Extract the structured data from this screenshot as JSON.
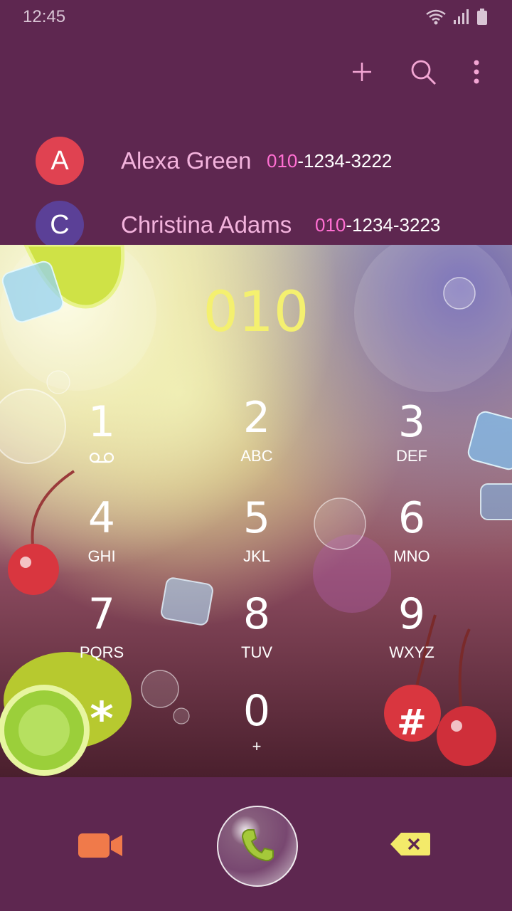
{
  "status_bar": {
    "time": "12:45"
  },
  "contacts": [
    {
      "initial": "A",
      "name": "Alexa Green",
      "number_match": "010",
      "number_rest": "-1234-3222"
    },
    {
      "initial": "C",
      "name": "Christina Adams",
      "number_match": "010",
      "number_rest": "-1234-3223"
    }
  ],
  "dialer": {
    "display": "010"
  },
  "keys": [
    {
      "digit": "1",
      "letters": ""
    },
    {
      "digit": "2",
      "letters": "ABC"
    },
    {
      "digit": "3",
      "letters": "DEF"
    },
    {
      "digit": "4",
      "letters": "GHI"
    },
    {
      "digit": "5",
      "letters": "JKL"
    },
    {
      "digit": "6",
      "letters": "MNO"
    },
    {
      "digit": "7",
      "letters": "PQRS"
    },
    {
      "digit": "8",
      "letters": "TUV"
    },
    {
      "digit": "9",
      "letters": "WXYZ"
    },
    {
      "digit": "*",
      "letters": ""
    },
    {
      "digit": "0",
      "letters": "+"
    },
    {
      "digit": "#",
      "letters": ""
    }
  ],
  "icons": {
    "action_bar": [
      "plus-icon",
      "search-icon",
      "more-vert-icon"
    ],
    "status": [
      "wifi-icon",
      "signal-icon",
      "battery-icon"
    ],
    "voicemail": "voicemail-icon",
    "video_call": "video-camera-icon",
    "call": "phone-icon",
    "delete": "backspace-icon"
  },
  "colors": {
    "background": "#5e2750",
    "accent": "#f3b3dd",
    "number_match": "#ff6fd2",
    "dial_display": "#f4f06f",
    "avatar_a": "#e04251",
    "avatar_c": "#5b4097",
    "video_icon": "#f07a4a",
    "delete_icon": "#f3ea6a"
  }
}
